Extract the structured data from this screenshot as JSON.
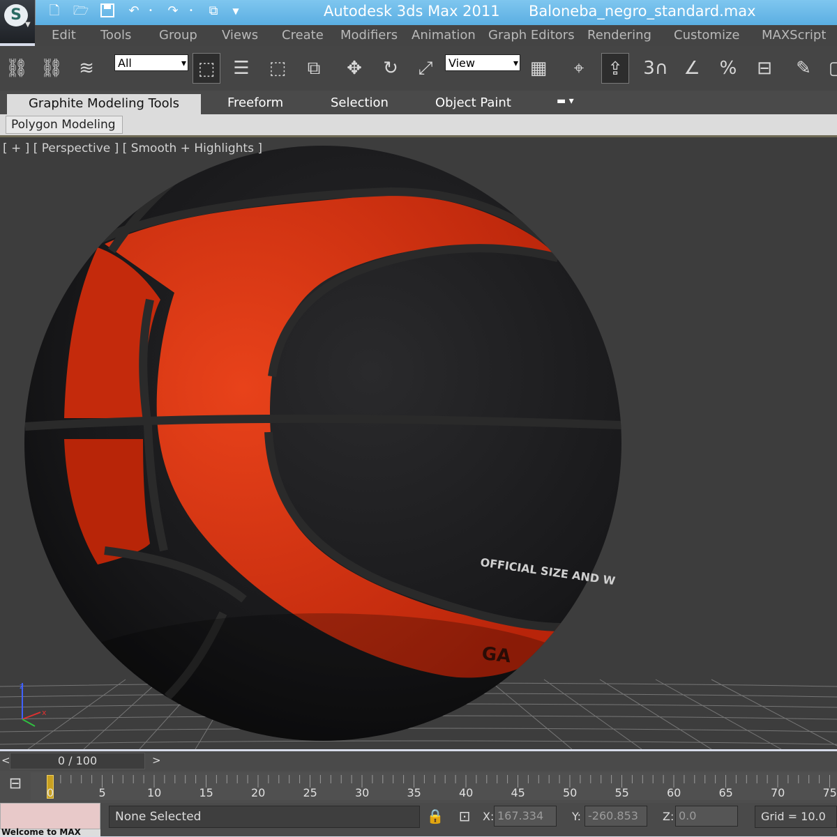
{
  "window": {
    "app_title": "Autodesk 3ds Max  2011",
    "file_title": "Baloneba_negro_standard.max"
  },
  "menu": [
    "Edit",
    "Tools",
    "Group",
    "Views",
    "Create",
    "Modifiers",
    "Animation",
    "Graph Editors",
    "Rendering",
    "Customize",
    "MAXScript"
  ],
  "toolbar": {
    "selection_filter": "All",
    "reference_coordinate_system": "View",
    "snap_toggle_label": "3",
    "angle_snap_label": "",
    "percent_snap_label": "%"
  },
  "ribbon": {
    "tabs": [
      "Graphite Modeling Tools",
      "Freeform",
      "Selection",
      "Object Paint"
    ],
    "active_tab": "Graphite Modeling Tools",
    "panel": "Polygon Modeling"
  },
  "viewport": {
    "label": "[ + ] [ Perspective ] [ Smooth + Highlights ]",
    "ball_text": "OFFICIAL SIZE AND W",
    "ball_brand": "GA",
    "colors": {
      "background": "#3d3d3d",
      "ball_black": "#1c1c1e",
      "ball_red": "#d8330e",
      "seam": "#2c2c2c",
      "grid": "#9a9a9a"
    }
  },
  "timeline": {
    "slider": "0 / 100",
    "prev": "<",
    "next": ">",
    "frames": [
      "0",
      "5",
      "10",
      "15",
      "20",
      "25",
      "30",
      "35",
      "40",
      "45",
      "50",
      "55",
      "60",
      "65",
      "70",
      "75"
    ]
  },
  "status": {
    "selection": "None Selected",
    "x_label": "X:",
    "x_value": "167.334",
    "y_label": "Y:",
    "y_value": "-260.853",
    "z_label": "Z:",
    "z_value": "0.0",
    "grid": "Grid = 10.0",
    "listener_prefix": "Welcome to MAX"
  }
}
